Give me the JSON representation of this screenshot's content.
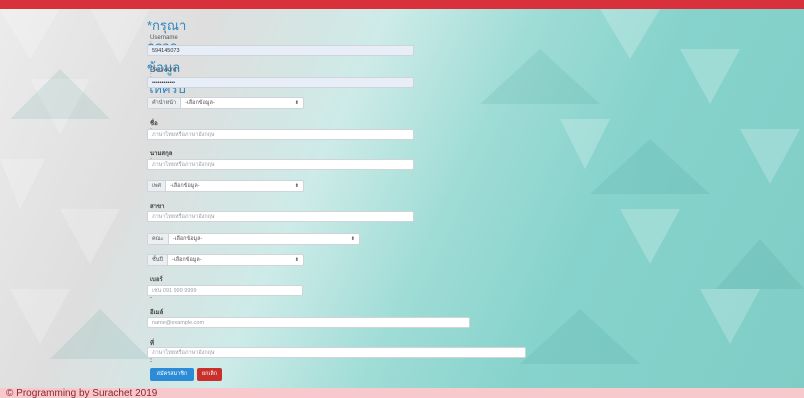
{
  "form": {
    "title": "*กรุณากรอกข้อมูลให้ครบ",
    "username_label": "Username :",
    "username_value": "594145073",
    "password_label": "Password :",
    "password_value": "••••••••••••",
    "prefix_addon": "คำนำหน้า",
    "prefix_value": "-เลือกข้อมูล-",
    "firstname_label": "ชื่อ :",
    "firstname_placeholder": "ภาษาไทยหรือภาษาอังกฤษ",
    "lastname_label": "นามสกุล :",
    "lastname_placeholder": "ภาษาไทยหรือภาษาอังกฤษ",
    "gender_addon": "เพศ",
    "gender_value": "-เลือกข้อมูล-",
    "major_label": "สาขาวิชา :",
    "major_placeholder": "ภาษาไทยหรือภาษาอังกฤษ",
    "faculty_addon": "คณะ",
    "faculty_value": "-เลือกข้อมูล-",
    "year_addon": "ชั้นปี",
    "year_value": "-เลือกข้อมูล-",
    "phone_label": "เบอร์โทร :",
    "phone_placeholder": "เช่น 091 999 9999",
    "email_label": "อีเมล์ :",
    "email_placeholder": "name@example.com",
    "address_label": "ที่อยู่ :",
    "address_placeholder": "ภาษาไทยหรือภาษาอังกฤษ",
    "submit_label": "สมัครสมาชิก",
    "cancel_label": "ยกเลิก"
  },
  "footer": {
    "text": "© Programming by Surachet 2019"
  },
  "colors": {
    "topbar": "#d8313c",
    "footer_bg": "#f7c9cd",
    "title": "#2e86c1",
    "submit": "#2b8bd6",
    "cancel": "#c9302c"
  },
  "icons": {
    "select_caret": "select-caret-icon"
  }
}
